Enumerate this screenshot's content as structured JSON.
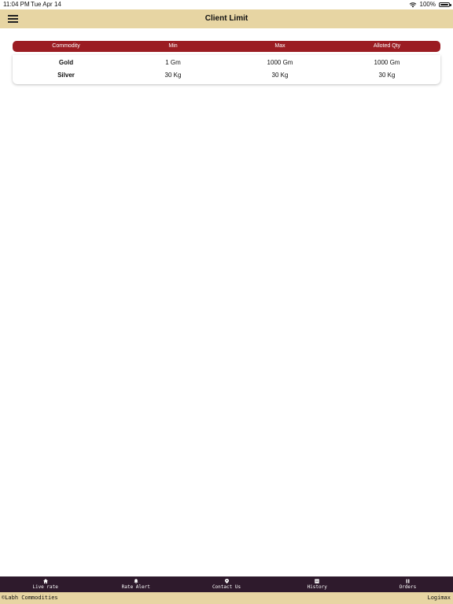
{
  "status_bar": {
    "time": "11:04 PM",
    "date": "Tue Apr 14",
    "battery": "100%",
    "icons": [
      "wifi-icon",
      "battery-icon"
    ]
  },
  "header": {
    "title": "Client Limit",
    "menu_icon": "hamburger-menu-icon"
  },
  "table": {
    "columns": [
      "Commodity",
      "Min",
      "Max",
      "Alloted Qty"
    ],
    "rows": [
      [
        "Gold",
        "1 Gm",
        "1000 Gm",
        "1000 Gm"
      ],
      [
        "Silver",
        "30 Kg",
        "30 Kg",
        "30 Kg"
      ]
    ]
  },
  "bottom_nav": {
    "items": [
      {
        "label": "Live rate",
        "icon": "home-icon"
      },
      {
        "label": "Rate Alert",
        "icon": "bell-icon"
      },
      {
        "label": "Contact Us",
        "icon": "location-pin-icon"
      },
      {
        "label": "History",
        "icon": "history-icon"
      },
      {
        "label": "Orders",
        "icon": "orders-icon"
      }
    ]
  },
  "footer": {
    "left": "©Labh Commodities",
    "right": "Logimax"
  },
  "colors": {
    "header_bg": "#e7d5a3",
    "table_header_bg": "#9b1c22",
    "bottom_nav_bg": "#2e1a2c"
  }
}
